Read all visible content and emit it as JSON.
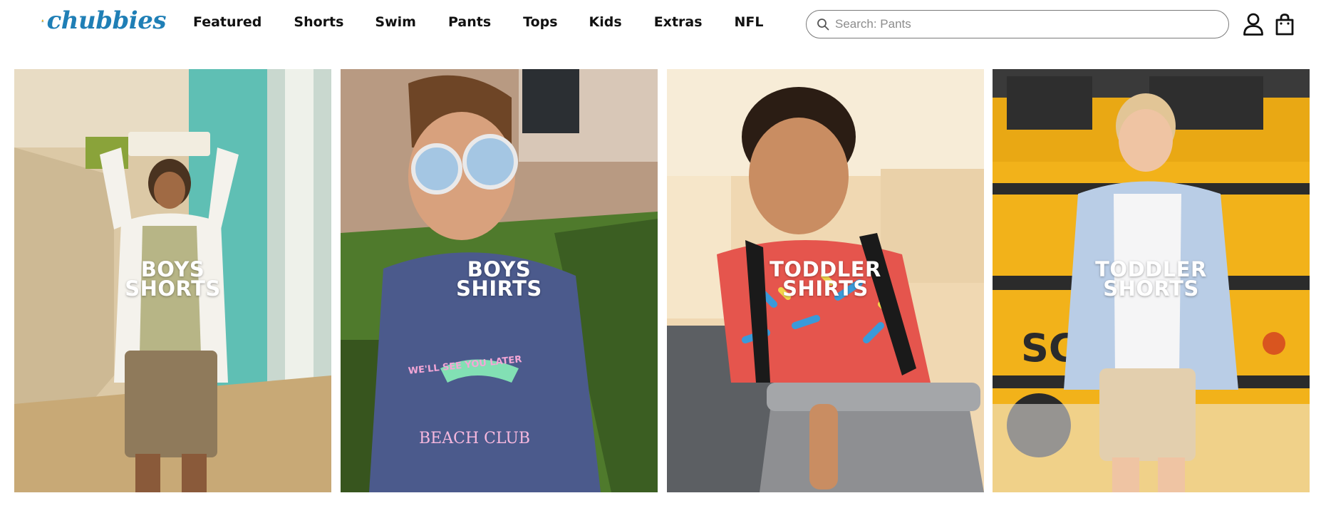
{
  "brand": {
    "name": "chubbies",
    "logo_icon": "pineapple-logo-icon",
    "color": "#1f7fb6"
  },
  "nav": {
    "items": [
      {
        "label": "Featured"
      },
      {
        "label": "Shorts"
      },
      {
        "label": "Swim"
      },
      {
        "label": "Pants"
      },
      {
        "label": "Tops"
      },
      {
        "label": "Kids"
      },
      {
        "label": "Extras"
      },
      {
        "label": "NFL"
      }
    ]
  },
  "search": {
    "placeholder": "Search: Pants",
    "value": "",
    "icon": "search-icon"
  },
  "header_icons": {
    "account": "account-icon",
    "cart": "shopping-bag-icon"
  },
  "tiles": [
    {
      "line1": "BOYS",
      "line2": "SHORTS"
    },
    {
      "line1": "BOYS",
      "line2": "SHIRTS"
    },
    {
      "line1": "TODDLER",
      "line2": "SHIRTS"
    },
    {
      "line1": "TODDLER",
      "line2": "SHORTS"
    }
  ],
  "tile_artwork": {
    "shirt_print_line1": "WE'LL SEE YOU LATER",
    "shirt_print_line2": "BEACH CLUB",
    "bus_lettering": "SCH"
  }
}
